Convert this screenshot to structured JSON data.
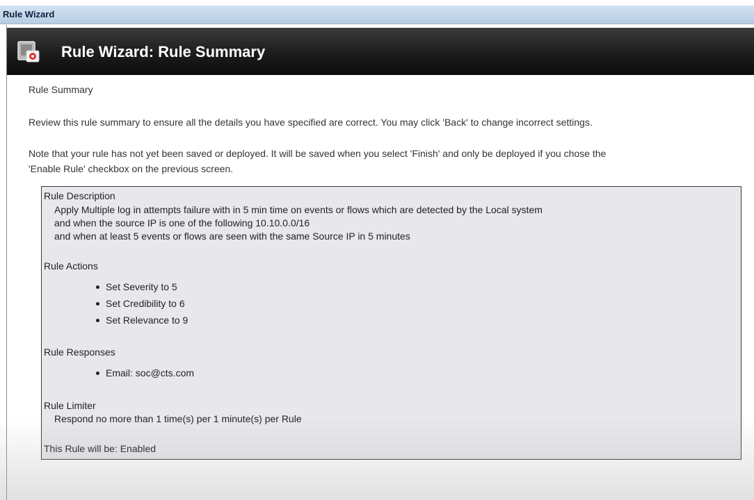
{
  "window": {
    "title": "Rule Wizard"
  },
  "header": {
    "title": "Rule Wizard: Rule Summary",
    "icon": "rule-wizard-icon"
  },
  "intro": {
    "heading": "Rule Summary",
    "review_text": "Review this rule summary to ensure all the details you have specified are correct. You may click 'Back' to change incorrect settings.",
    "note_line1": "Note that your rule has not yet been saved or deployed. It will be saved when you select 'Finish' and only be deployed if you chose the",
    "note_line2": "'Enable Rule' checkbox on the previous screen."
  },
  "summary": {
    "description_label": "Rule Description",
    "description_lines": [
      "Apply Multiple log in attempts failure with in 5 min time on events or flows which are detected by the Local system",
      "and when the source IP is one of the following 10.10.0.0/16",
      "and when at least 5 events or flows are seen with the same Source IP in 5 minutes"
    ],
    "actions_label": "Rule Actions",
    "actions": [
      "Set Severity to 5",
      "Set Credibility to 6",
      "Set Relevance to 9"
    ],
    "responses_label": "Rule Responses",
    "responses": [
      "Email: soc@cts.com"
    ],
    "limiter_label": "Rule Limiter",
    "limiter_text": "Respond no more than 1 time(s) per 1 minute(s) per Rule",
    "status_text": "This Rule will be: Enabled"
  },
  "colors": {
    "titlebar": "#c4d6ec",
    "header": "#1c1c1c",
    "summary_background": "#e8e8ec",
    "icon_accent": "#e03030"
  }
}
